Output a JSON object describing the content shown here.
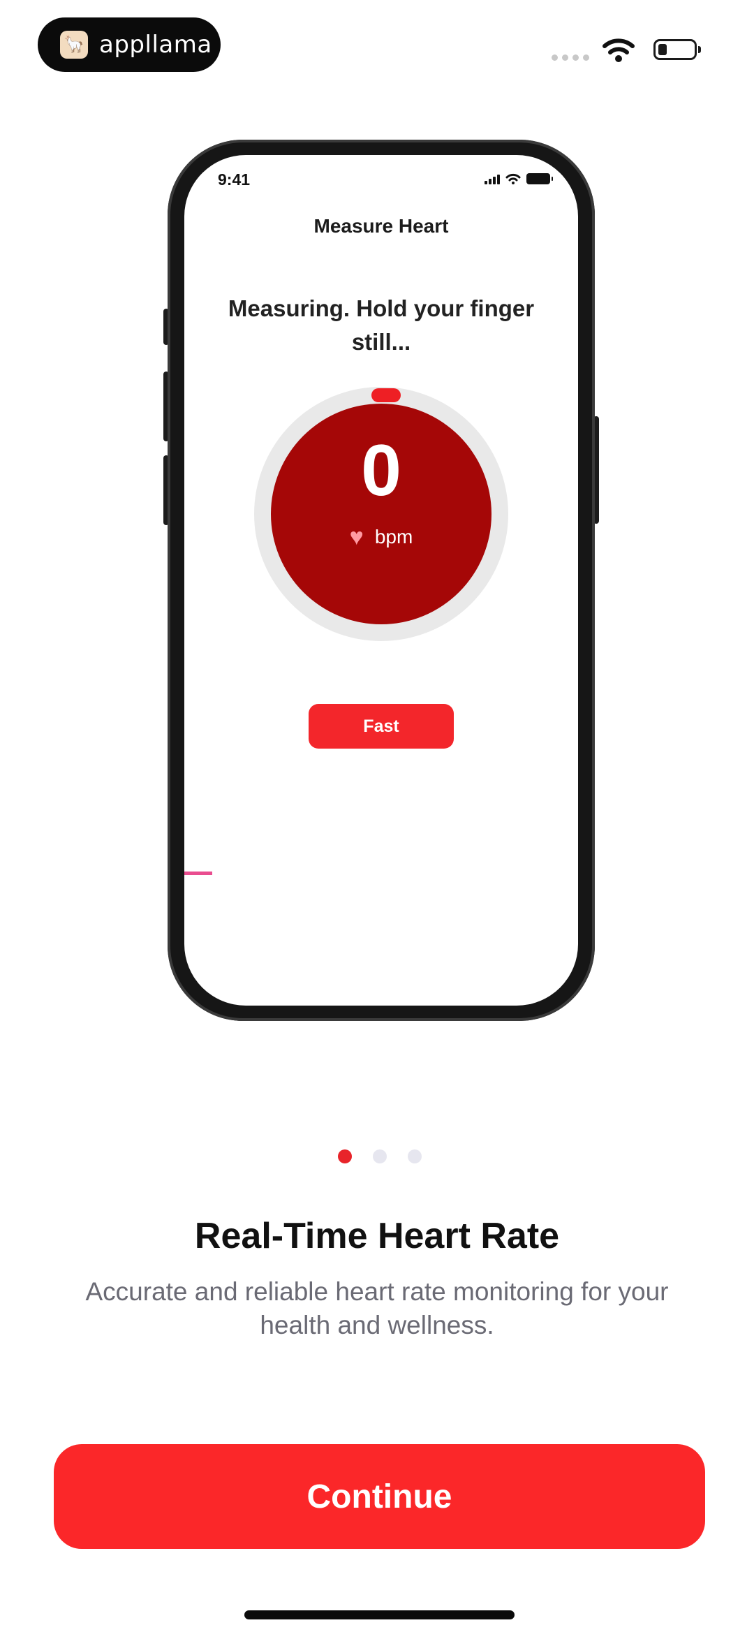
{
  "brand": {
    "name": "appllama",
    "logo_icon": "llama-icon"
  },
  "status_bar": {
    "signal_icon": "cellular-dots-icon",
    "wifi_icon": "wifi-icon",
    "battery_icon": "battery-low-icon"
  },
  "mockup": {
    "status_time": "9:41",
    "title": "Measure Heart",
    "message": "Measuring. Hold your finger still...",
    "bpm_value": "0",
    "bpm_unit": "bpm",
    "heart_icon": "heart-icon",
    "mode_button": "Fast"
  },
  "pager": {
    "total": 3,
    "active_index": 0,
    "active_color": "#e8242a",
    "inactive_color": "#e6e6ef"
  },
  "onboarding": {
    "title": "Real-Time Heart Rate",
    "description": "Accurate and reliable heart rate monitoring for your health and wellness."
  },
  "actions": {
    "continue_label": "Continue"
  },
  "colors": {
    "accent": "#fb2729",
    "dial": "#a50707",
    "text_secondary": "#6a6a74"
  }
}
